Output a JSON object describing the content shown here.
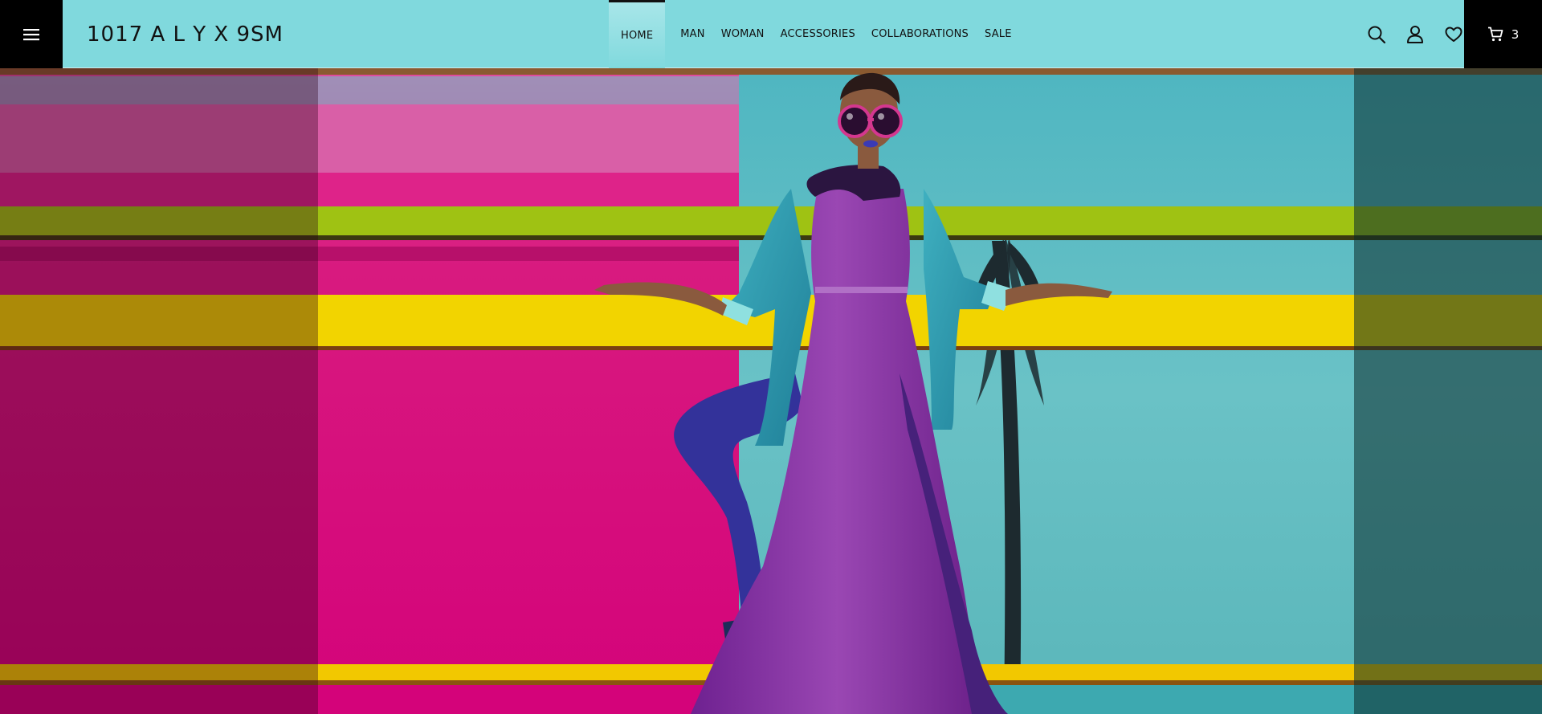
{
  "brand": {
    "logo_text": "1017 A L Y X 9SM"
  },
  "nav": {
    "items": [
      {
        "label": "HOME",
        "active": true
      },
      {
        "label": "MAN",
        "active": false
      },
      {
        "label": "WOMAN",
        "active": false
      },
      {
        "label": "ACCESSORIES",
        "active": false
      },
      {
        "label": "COLLABORATIONS",
        "active": false
      },
      {
        "label": "SALE",
        "active": false
      }
    ]
  },
  "header_icons": {
    "menu": "hamburger-menu-icon",
    "search": "search-icon",
    "account": "user-icon",
    "wishlist": "heart-icon",
    "cart": "cart-icon"
  },
  "cart": {
    "count": "3"
  },
  "colors": {
    "header_bg": "#80d9dd",
    "accent_black": "#000000",
    "hero_pink": "#d8077a",
    "hero_yellow": "#f2d400",
    "hero_lime": "#9cbf10",
    "hero_sky": "#5ab6ba",
    "dress_purple": "#8a3aa6"
  }
}
